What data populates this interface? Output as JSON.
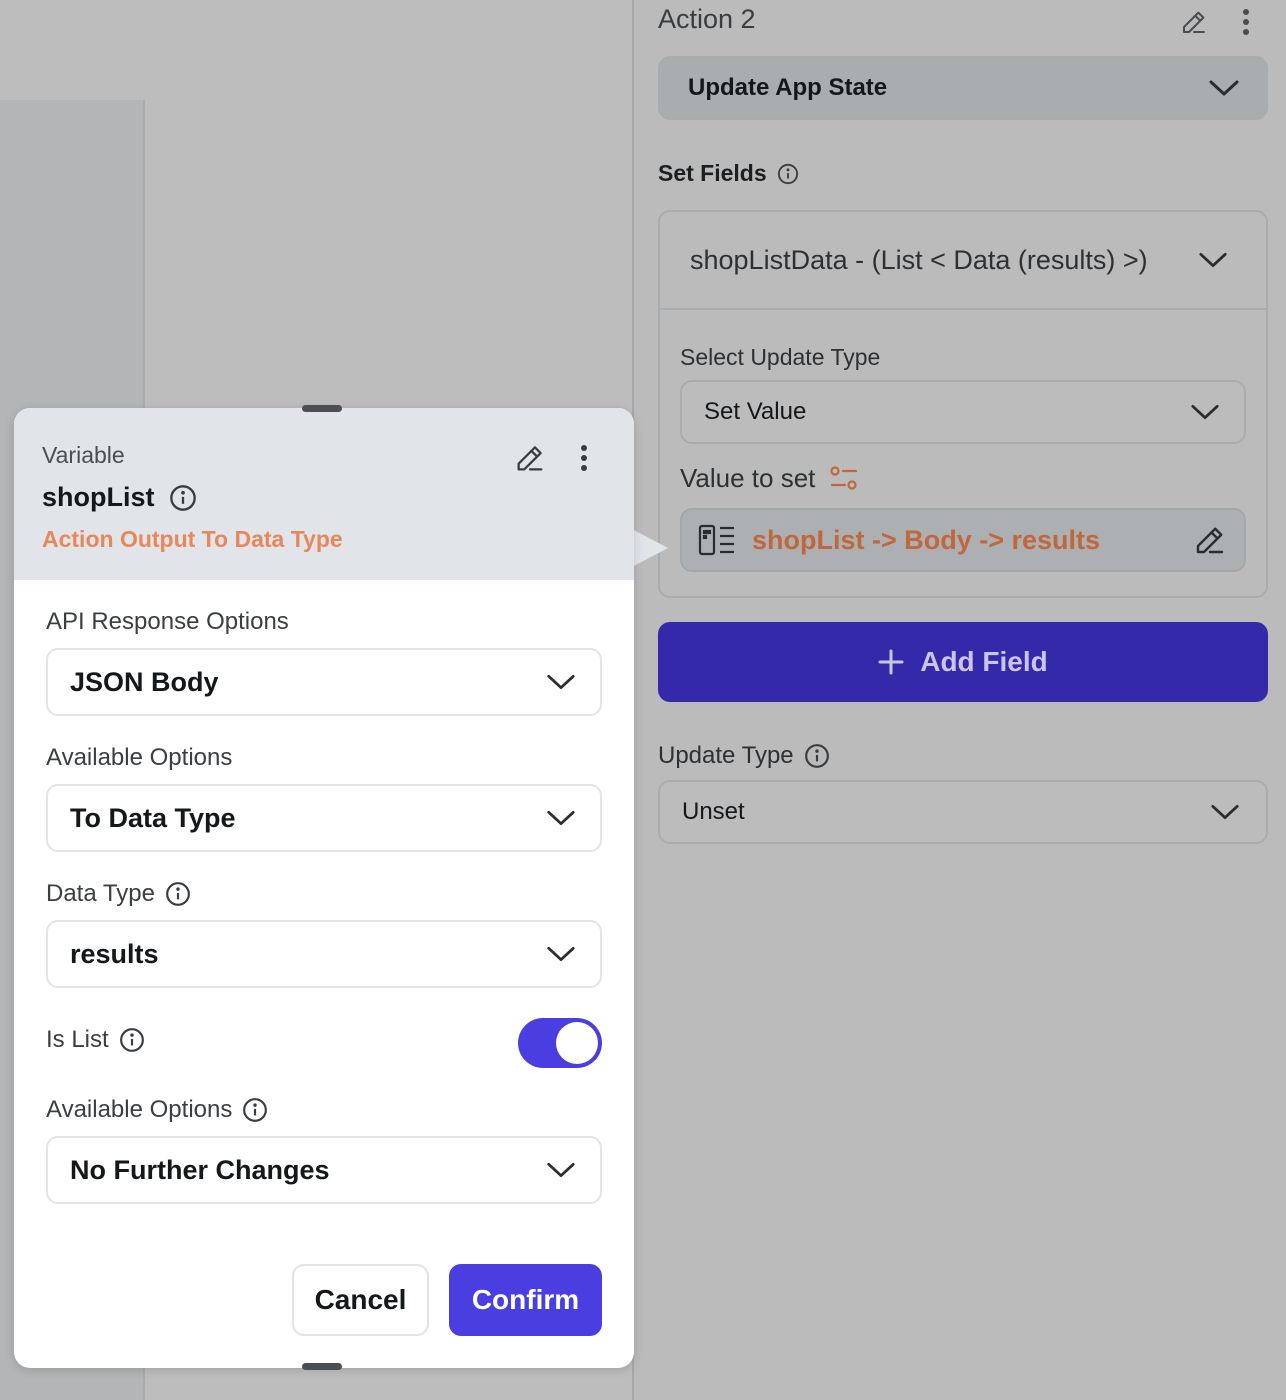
{
  "action": {
    "title": "Action 2",
    "type_value": "Update App State"
  },
  "set_fields": {
    "label": "Set Fields",
    "field_header": "shopListData - (List < Data (results) >)",
    "select_update_type_label": "Select Update Type",
    "update_type_value": "Set Value",
    "value_to_set_label": "Value to set",
    "value_to_set": "shopList -> Body -> results"
  },
  "add_field_label": "Add Field",
  "update_type": {
    "label": "Update Type",
    "value": "Unset"
  },
  "modal": {
    "kind": "Variable",
    "name": "shopList",
    "subtitle": "Action Output To Data Type",
    "api_response_label": "API Response Options",
    "api_response_value": "JSON Body",
    "available_options_label": "Available Options",
    "available_options_value": "To Data Type",
    "data_type_label": "Data Type",
    "data_type_value": "results",
    "is_list_label": "Is List",
    "is_list": true,
    "available_options2_label": "Available Options",
    "available_options2_value": "No Further Changes",
    "cancel_label": "Cancel",
    "confirm_label": "Confirm"
  },
  "colors": {
    "accent": "#4b3ee0",
    "subtitle_orange": "#e8875a",
    "value_orange": "#c0673b"
  },
  "icons": [
    "edit-pencil-icon",
    "more-vertical-icon",
    "chevron-down-icon",
    "info-icon",
    "variable-settings-icon",
    "data-table-icon",
    "plus-icon"
  ]
}
